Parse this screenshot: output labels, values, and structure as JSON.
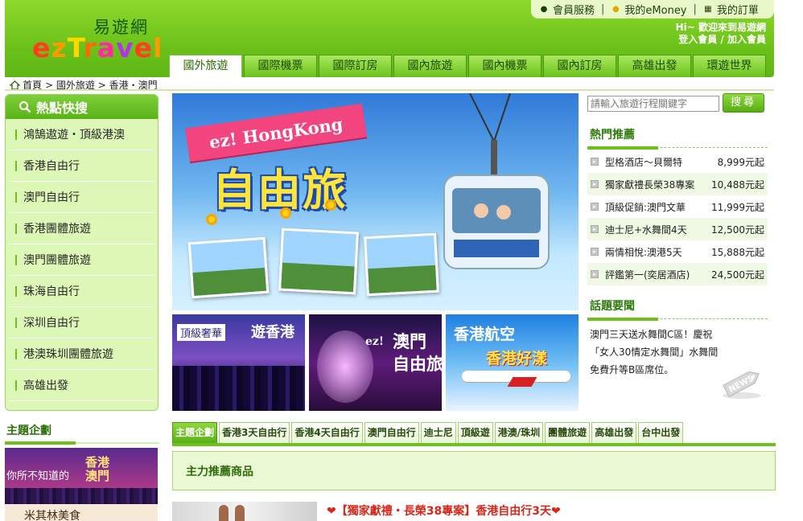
{
  "header": {
    "logo_cn": "易遊網",
    "logo_en": "ezTravel",
    "member_bar": {
      "service": "會員服務",
      "emoney": "我的eMoney",
      "orders": "我的訂單"
    },
    "welcome": "Hi~ 歡迎來到易遊網",
    "login": "登入會員 / 加入會員"
  },
  "nav": {
    "tabs": [
      "國外旅遊",
      "國際機票",
      "國際訂房",
      "國內旅遊",
      "國內機票",
      "國內訂房",
      "高雄出發",
      "環遊世界"
    ]
  },
  "breadcrumb": {
    "home": "首頁",
    "path": "> 國外旅遊 > 香港・澳門"
  },
  "sidebar": {
    "title": "熱點快搜",
    "items": [
      "鴻鵠遨遊・頂級港澳",
      "香港自由行",
      "澳門自由行",
      "香港團體旅遊",
      "澳門團體旅遊",
      "珠海自由行",
      "深圳自由行",
      "港澳珠圳團體旅遊",
      "高雄出發"
    ],
    "theme_heading": "主題企劃",
    "theme_banner": {
      "line1": "你所不知道的",
      "line2": "香港\n澳門",
      "line3": "米其林美食"
    }
  },
  "hero": {
    "ribbon": "ez! HongKong",
    "title": "自由旅"
  },
  "sub_banners": {
    "b1_tag": "頂級奢華",
    "b1_text": "遊香港",
    "b2_badge": "ez!",
    "b2_title": "澳門\n自由旅",
    "b3_line1": "香港航空",
    "b3_line2": "香港好漾"
  },
  "search": {
    "placeholder": "請輸入旅遊行程關鍵字",
    "button": "搜尋"
  },
  "hot_recommend": {
    "heading": "熱門推薦",
    "deals": [
      {
        "name": "型格酒店～貝爾特",
        "price": "8,999元起"
      },
      {
        "name": "獨家獻禮長榮38專案",
        "price": "10,488元起"
      },
      {
        "name": "頂級促銷:澳門文華",
        "price": "11,999元起"
      },
      {
        "name": "迪士尼+水舞間4天",
        "price": "12,500元起"
      },
      {
        "name": "兩情相悅:澳港5天",
        "price": "15,888元起"
      },
      {
        "name": "評鑑第一(奕居酒店)",
        "price": "24,500元起"
      }
    ]
  },
  "news": {
    "heading": "話題要聞",
    "text": "澳門三天送水舞間C區！慶祝「女人30情定水舞間」水舞間免費升等B區席位。",
    "badge": "NEWS"
  },
  "theme_tabs": [
    "主題企劃",
    "香港3天自由行",
    "香港4天自由行",
    "澳門自由行",
    "迪士尼",
    "頂級遊",
    "港澳/珠圳",
    "團體旅遊",
    "高雄出發",
    "台中出發"
  ],
  "feature": {
    "title": "主力推薦商品"
  },
  "promo": {
    "title": "❤【獨家獻禮・長榮38專案】香港自由行3天❤"
  },
  "colors": {
    "brand_green": "#6cc21a",
    "price_red": "#d6281a",
    "panel_green": "#ddf7b6"
  }
}
